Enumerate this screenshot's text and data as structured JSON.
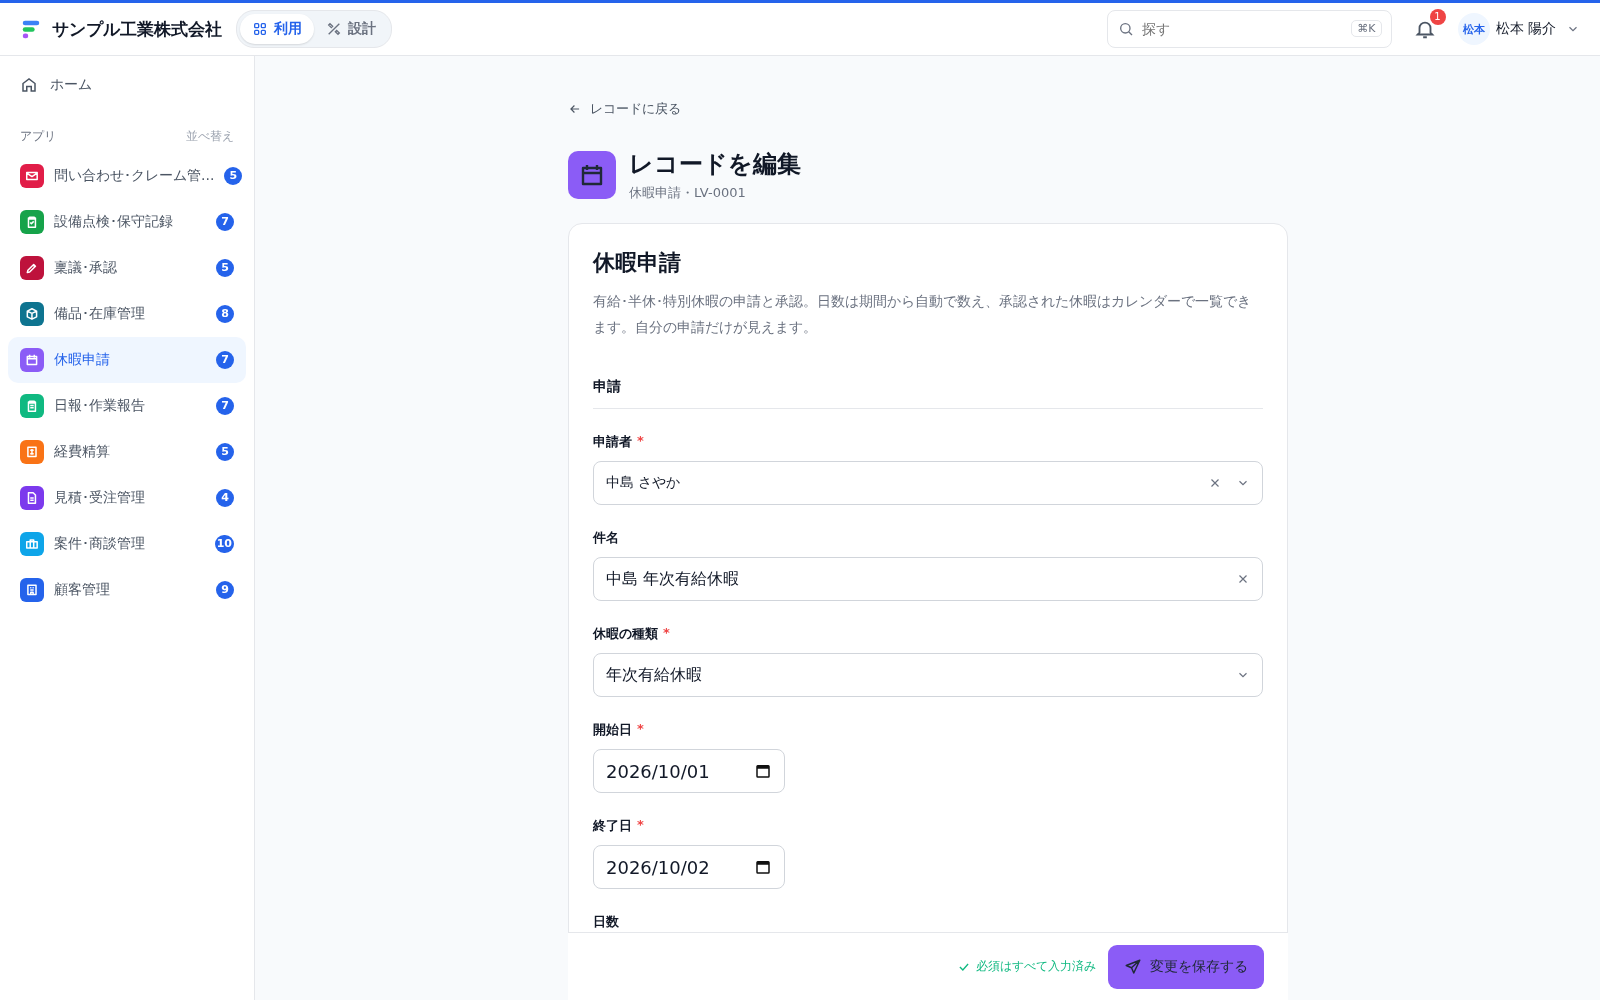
{
  "header": {
    "company": "サンプル工業株式会社",
    "modes": [
      {
        "label": "利用",
        "selected": true
      },
      {
        "label": "設計",
        "selected": false
      }
    ],
    "search": {
      "placeholder": "探す",
      "shortcut": "⌘K"
    },
    "notifications": {
      "count": "1"
    },
    "user": {
      "avatar": "松本",
      "name": "松本 陽介"
    }
  },
  "sidebar": {
    "home": "ホーム",
    "section": "アプリ",
    "sort": "並べ替え",
    "items": [
      {
        "label": "問い合わせ･クレーム管...",
        "count": "5",
        "color": "#e11d48",
        "selected": false
      },
      {
        "label": "設備点検･保守記録",
        "count": "7",
        "color": "#16a34a",
        "selected": false
      },
      {
        "label": "稟議･承認",
        "count": "5",
        "color": "#be123c",
        "selected": false
      },
      {
        "label": "備品･在庫管理",
        "count": "8",
        "color": "#0e7490",
        "selected": false
      },
      {
        "label": "休暇申請",
        "count": "7",
        "color": "#8b5cf6",
        "selected": true
      },
      {
        "label": "日報･作業報告",
        "count": "7",
        "color": "#10b981",
        "selected": false
      },
      {
        "label": "経費精算",
        "count": "5",
        "color": "#f97316",
        "selected": false
      },
      {
        "label": "見積･受注管理",
        "count": "4",
        "color": "#7c3aed",
        "selected": false
      },
      {
        "label": "案件･商談管理",
        "count": "10",
        "color": "#0ea5e9",
        "selected": false
      },
      {
        "label": "顧客管理",
        "count": "9",
        "color": "#2563eb",
        "selected": false
      }
    ]
  },
  "page": {
    "back": "レコードに戻る",
    "title": "レコードを編集",
    "subtitle": "休暇申請・LV-0001"
  },
  "form": {
    "title": "休暇申請",
    "description": "有給･半休･特別休暇の申請と承認。日数は期間から自動で数え、承認された休暇はカレンダーで一覧できます。自分の申請だけが見えます。",
    "section": "申請",
    "fields": [
      {
        "kind": "select",
        "label": "申請者",
        "required_mark": "*",
        "value": "中島 さやか",
        "clearable": true
      },
      {
        "kind": "text",
        "label": "件名",
        "value": "中島 年次有給休暇",
        "clearable": true
      },
      {
        "kind": "select",
        "label": "休暇の種類",
        "required_mark": "*",
        "value": "年次有給休暇"
      },
      {
        "kind": "date",
        "label": "開始日",
        "required_mark": "*",
        "value": "2026/10/01"
      },
      {
        "kind": "date",
        "label": "終了日",
        "required_mark": "*",
        "value": "2026/10/02"
      },
      {
        "kind": "number",
        "label": "日数"
      }
    ]
  },
  "footer": {
    "status": "必須はすべて入力済み",
    "save": "変更を保存する"
  }
}
